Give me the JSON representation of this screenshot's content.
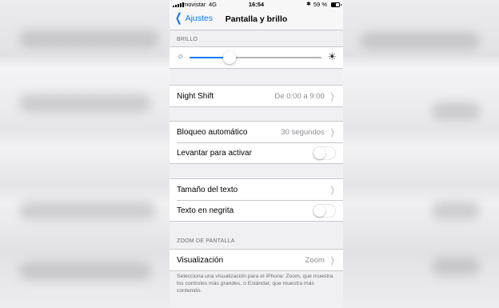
{
  "status_bar": {
    "carrier": "movistar",
    "network": "4G",
    "time": "16:54",
    "battery": "59 %",
    "bluetooth_icon": "bluetooth-icon"
  },
  "nav": {
    "back_label": "Ajustes",
    "title": "Pantalla y brillo"
  },
  "brightness": {
    "header": "BRILLO",
    "level_percent": 30
  },
  "night_shift": {
    "label": "Night Shift",
    "value": "De 0:00 a 9:00"
  },
  "lock": {
    "auto_lock_label": "Bloqueo automático",
    "auto_lock_value": "30 segundos",
    "raise_to_wake_label": "Levantar para activar",
    "raise_to_wake_on": false
  },
  "text": {
    "size_label": "Tamaño del texto",
    "bold_label": "Texto en negrita",
    "bold_on": false
  },
  "zoom": {
    "header": "ZOOM DE PANTALLA",
    "view_label": "Visualización",
    "view_value": "Zoom",
    "footer": "Selecciona una visualización para el iPhone: Zoom, que muestra los controles más grandes, o Estándar, que muestra más contenido."
  },
  "colors": {
    "accent": "#0a7aff",
    "background": "#efeff4",
    "secondary_text": "#8e8e93"
  }
}
